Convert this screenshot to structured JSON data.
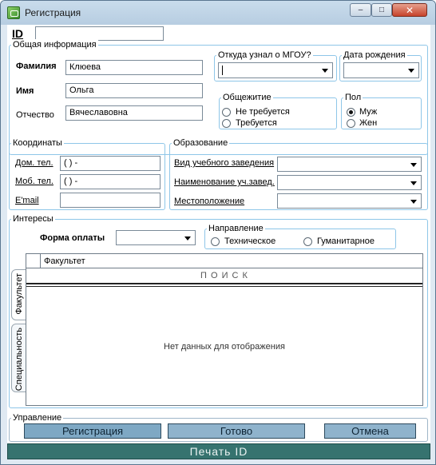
{
  "window": {
    "title": "Регистрация",
    "min": "–",
    "max": "□",
    "close": "✕"
  },
  "id_field": {
    "label": "ID",
    "value": ""
  },
  "general": {
    "title": "Общая информация",
    "surname_label": "Фамилия",
    "surname_value": "Клюева",
    "name_label": "Имя",
    "name_value": "Ольга",
    "patronymic_label": "Отчество",
    "patronymic_value": "Вячеславовна",
    "source_title": "Откуда узнал о МГОУ?",
    "birth_title": "Дата рождения",
    "dorm_title": "Общежитие",
    "dorm_options": [
      {
        "label": "Не требуется",
        "checked": false
      },
      {
        "label": "Требуется",
        "checked": false
      }
    ],
    "gender_title": "Пол",
    "gender_options": [
      {
        "label": "Муж",
        "checked": true
      },
      {
        "label": "Жен",
        "checked": false
      }
    ]
  },
  "contacts": {
    "title": "Координаты",
    "home_label": "Дом. тел.",
    "home_value": "(  )   -",
    "mobile_label": "Моб. тел.",
    "mobile_value": "(  )   -",
    "email_label": "E'mail",
    "email_value": ""
  },
  "education": {
    "title": "Образование",
    "type_label": "Вид учебного заведения",
    "name_label": "Наименование уч.завед.",
    "location_label": "Местоположение"
  },
  "interests": {
    "title": "Интересы",
    "payment_label": "Форма оплаты",
    "direction_title": "Направление",
    "direction_options": [
      {
        "label": "Техническое",
        "checked": false
      },
      {
        "label": "Гуманитарное",
        "checked": false
      }
    ],
    "tabs": [
      "Факультет",
      "Специальность"
    ],
    "grid_header": "Факультет",
    "search_label": "П О И С К",
    "empty_text": "Нет данных для отображения"
  },
  "management": {
    "title": "Управление",
    "register_label": "Регистрация",
    "done_label": "Готово",
    "cancel_label": "Отмена",
    "print_label": "Печать ID"
  }
}
